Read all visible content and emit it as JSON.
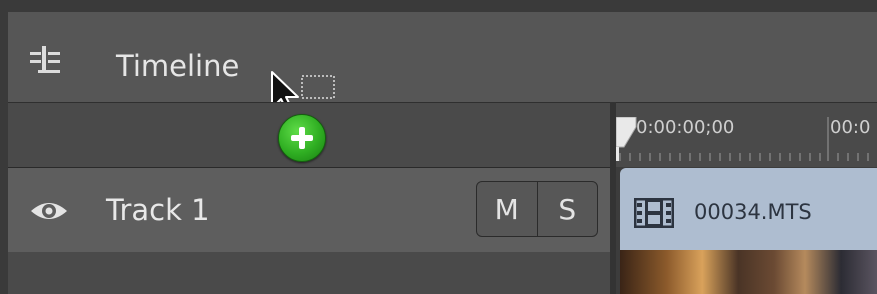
{
  "panel": {
    "title": "Timeline",
    "title_icon": "timeline-icon"
  },
  "drag": {
    "cursor_icon": "arrow-cursor-icon",
    "add_icon": "plus-circle-icon"
  },
  "ruler": {
    "timecodes": [
      "0:00:00;00",
      "00:0"
    ]
  },
  "tracks": [
    {
      "visibility_icon": "eye-icon",
      "name": "Track 1",
      "mute_label": "M",
      "solo_label": "S",
      "clip": {
        "icon": "film-strip-icon",
        "name": "00034.MTS"
      }
    }
  ],
  "colors": {
    "background": "#3a3a3a",
    "header": "#565656",
    "track_header": "#5e5e5e",
    "clip": "#aebdd0",
    "add_button": "#2fae22"
  }
}
